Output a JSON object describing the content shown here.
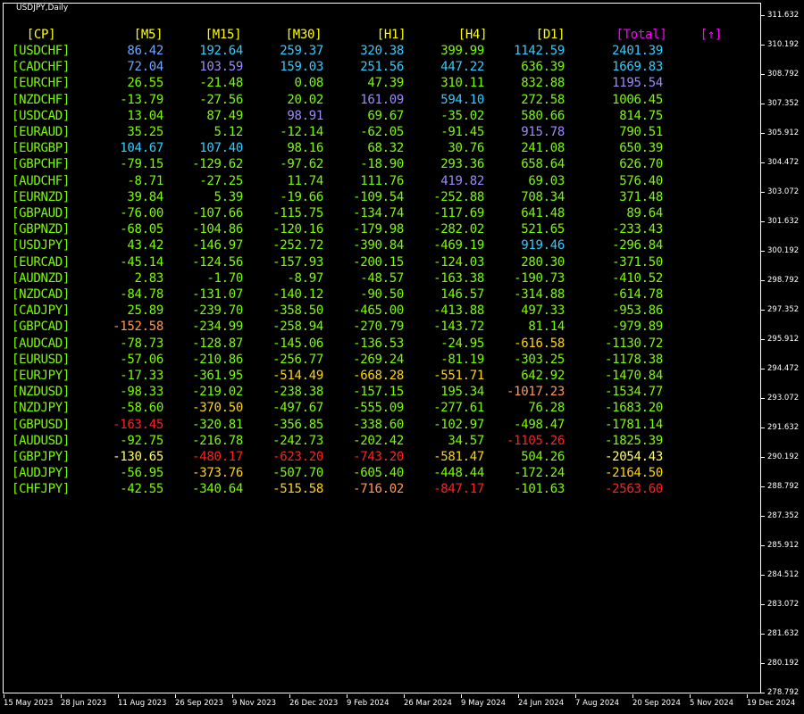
{
  "chart": {
    "title": "USDJPY,Daily",
    "price_labels": [
      "311.632",
      "310.192",
      "308.792",
      "307.352",
      "305.912",
      "304.472",
      "303.072",
      "301.632",
      "300.192",
      "298.792",
      "297.352",
      "295.912",
      "294.472",
      "293.072",
      "291.632",
      "290.192",
      "288.792",
      "287.352",
      "285.912",
      "284.512",
      "283.072",
      "281.632",
      "280.192",
      "278.792"
    ],
    "time_labels": [
      "15 May 2023",
      "28 Jun 2023",
      "11 Aug 2023",
      "26 Sep 2023",
      "9 Nov 2023",
      "26 Dec 2023",
      "9 Feb 2024",
      "26 Mar 2024",
      "9 May 2024",
      "24 Jun 2024",
      "7 Aug 2024",
      "20 Sep 2024",
      "5 Nov 2024",
      "19 Dec 2024"
    ]
  },
  "table": {
    "headers": [
      "[CP]",
      "[M5]",
      "[M15]",
      "[M30]",
      "[H1]",
      "[H4]",
      "[D1]",
      "[Total]",
      "[↑]"
    ],
    "header_colors": [
      "#ffff00",
      "#ffff00",
      "#ffff00",
      "#ffff00",
      "#ffff00",
      "#ffff00",
      "#ffff00",
      "#ff00ff",
      "#ff00ff"
    ],
    "rows": [
      {
        "pair": "[USDCHF]",
        "vals": [
          "86.42",
          "192.64",
          "259.37",
          "320.38",
          "399.99",
          "1142.59",
          "2401.39"
        ],
        "colors": [
          "#6fa8ff",
          "#33ccff",
          "#33ccff",
          "#33ccff",
          "#7cfc00",
          "#33ccff",
          "#33ccff"
        ]
      },
      {
        "pair": "[CADCHF]",
        "vals": [
          "72.04",
          "103.59",
          "159.03",
          "251.56",
          "447.22",
          "636.39",
          "1669.83"
        ],
        "colors": [
          "#6fa8ff",
          "#9b8cff",
          "#33ccff",
          "#33ccff",
          "#33ccff",
          "#7cfc00",
          "#33ccff"
        ]
      },
      {
        "pair": "[EURCHF]",
        "vals": [
          "26.55",
          "-21.48",
          "0.08",
          "47.39",
          "310.11",
          "832.88",
          "1195.54"
        ],
        "colors": [
          "#7cfc00",
          "#7cfc00",
          "#7cfc00",
          "#7cfc00",
          "#7cfc00",
          "#7cfc00",
          "#9b8cff"
        ]
      },
      {
        "pair": "[NZDCHF]",
        "vals": [
          "-13.79",
          "-27.56",
          "20.02",
          "161.09",
          "594.10",
          "272.58",
          "1006.45"
        ],
        "colors": [
          "#7cfc00",
          "#7cfc00",
          "#7cfc00",
          "#9b8cff",
          "#33ccff",
          "#7cfc00",
          "#7cfc00"
        ]
      },
      {
        "pair": "[USDCAD]",
        "vals": [
          "13.04",
          "87.49",
          "98.91",
          "69.67",
          "-35.02",
          "580.66",
          "814.75"
        ],
        "colors": [
          "#7cfc00",
          "#7cfc00",
          "#9b8cff",
          "#7cfc00",
          "#7cfc00",
          "#7cfc00",
          "#7cfc00"
        ]
      },
      {
        "pair": "[EURAUD]",
        "vals": [
          "35.25",
          "5.12",
          "-12.14",
          "-62.05",
          "-91.45",
          "915.78",
          "790.51"
        ],
        "colors": [
          "#7cfc00",
          "#7cfc00",
          "#7cfc00",
          "#7cfc00",
          "#7cfc00",
          "#9b8cff",
          "#7cfc00"
        ]
      },
      {
        "pair": "[EURGBP]",
        "vals": [
          "104.67",
          "107.40",
          "98.16",
          "68.32",
          "30.76",
          "241.08",
          "650.39"
        ],
        "colors": [
          "#33ccff",
          "#33ccff",
          "#7cfc00",
          "#7cfc00",
          "#7cfc00",
          "#7cfc00",
          "#7cfc00"
        ]
      },
      {
        "pair": "[GBPCHF]",
        "vals": [
          "-79.15",
          "-129.62",
          "-97.62",
          "-18.90",
          "293.36",
          "658.64",
          "626.70"
        ],
        "colors": [
          "#7cfc00",
          "#7cfc00",
          "#7cfc00",
          "#7cfc00",
          "#7cfc00",
          "#7cfc00",
          "#7cfc00"
        ]
      },
      {
        "pair": "[AUDCHF]",
        "vals": [
          "-8.71",
          "-27.25",
          "11.74",
          "111.76",
          "419.82",
          "69.03",
          "576.40"
        ],
        "colors": [
          "#7cfc00",
          "#7cfc00",
          "#7cfc00",
          "#7cfc00",
          "#9b8cff",
          "#7cfc00",
          "#7cfc00"
        ]
      },
      {
        "pair": "[EURNZD]",
        "vals": [
          "39.84",
          "5.39",
          "-19.66",
          "-109.54",
          "-252.88",
          "708.34",
          "371.48"
        ],
        "colors": [
          "#7cfc00",
          "#7cfc00",
          "#7cfc00",
          "#7cfc00",
          "#7cfc00",
          "#7cfc00",
          "#7cfc00"
        ]
      },
      {
        "pair": "[GBPAUD]",
        "vals": [
          "-76.00",
          "-107.66",
          "-115.75",
          "-134.74",
          "-117.69",
          "641.48",
          "89.64"
        ],
        "colors": [
          "#7cfc00",
          "#7cfc00",
          "#7cfc00",
          "#7cfc00",
          "#7cfc00",
          "#7cfc00",
          "#7cfc00"
        ]
      },
      {
        "pair": "[GBPNZD]",
        "vals": [
          "-68.05",
          "-104.86",
          "-120.16",
          "-179.98",
          "-282.02",
          "521.65",
          "-233.43"
        ],
        "colors": [
          "#7cfc00",
          "#7cfc00",
          "#7cfc00",
          "#7cfc00",
          "#7cfc00",
          "#7cfc00",
          "#7cfc00"
        ]
      },
      {
        "pair": "[USDJPY]",
        "vals": [
          "43.42",
          "-146.97",
          "-252.72",
          "-390.84",
          "-469.19",
          "919.46",
          "-296.84"
        ],
        "colors": [
          "#7cfc00",
          "#7cfc00",
          "#7cfc00",
          "#7cfc00",
          "#7cfc00",
          "#33ccff",
          "#7cfc00"
        ]
      },
      {
        "pair": "[EURCAD]",
        "vals": [
          "-45.14",
          "-124.56",
          "-157.93",
          "-200.15",
          "-124.03",
          "280.30",
          "-371.50"
        ],
        "colors": [
          "#7cfc00",
          "#7cfc00",
          "#7cfc00",
          "#7cfc00",
          "#7cfc00",
          "#7cfc00",
          "#7cfc00"
        ]
      },
      {
        "pair": "[AUDNZD]",
        "vals": [
          "2.83",
          "-1.70",
          "-8.97",
          "-48.57",
          "-163.38",
          "-190.73",
          "-410.52"
        ],
        "colors": [
          "#7cfc00",
          "#7cfc00",
          "#7cfc00",
          "#7cfc00",
          "#7cfc00",
          "#7cfc00",
          "#7cfc00"
        ]
      },
      {
        "pair": "[NZDCAD]",
        "vals": [
          "-84.78",
          "-131.07",
          "-140.12",
          "-90.50",
          "146.57",
          "-314.88",
          "-614.78"
        ],
        "colors": [
          "#7cfc00",
          "#7cfc00",
          "#7cfc00",
          "#7cfc00",
          "#7cfc00",
          "#7cfc00",
          "#7cfc00"
        ]
      },
      {
        "pair": "[CADJPY]",
        "vals": [
          "25.89",
          "-239.70",
          "-358.50",
          "-465.00",
          "-413.88",
          "497.33",
          "-953.86"
        ],
        "colors": [
          "#7cfc00",
          "#7cfc00",
          "#7cfc00",
          "#7cfc00",
          "#7cfc00",
          "#7cfc00",
          "#7cfc00"
        ]
      },
      {
        "pair": "[GBPCAD]",
        "vals": [
          "-152.58",
          "-234.99",
          "-258.94",
          "-270.79",
          "-143.72",
          "81.14",
          "-979.89"
        ],
        "colors": [
          "#ff9955",
          "#7cfc00",
          "#7cfc00",
          "#7cfc00",
          "#7cfc00",
          "#7cfc00",
          "#7cfc00"
        ]
      },
      {
        "pair": "[AUDCAD]",
        "vals": [
          "-78.73",
          "-128.87",
          "-145.06",
          "-136.53",
          "-24.95",
          "-616.58",
          "-1130.72"
        ],
        "colors": [
          "#7cfc00",
          "#7cfc00",
          "#7cfc00",
          "#7cfc00",
          "#7cfc00",
          "#ffd700",
          "#7cfc00"
        ]
      },
      {
        "pair": "[EURUSD]",
        "vals": [
          "-57.06",
          "-210.86",
          "-256.77",
          "-269.24",
          "-81.19",
          "-303.25",
          "-1178.38"
        ],
        "colors": [
          "#7cfc00",
          "#7cfc00",
          "#7cfc00",
          "#7cfc00",
          "#7cfc00",
          "#7cfc00",
          "#7cfc00"
        ]
      },
      {
        "pair": "[EURJPY]",
        "vals": [
          "-17.33",
          "-361.95",
          "-514.49",
          "-668.28",
          "-551.71",
          "642.92",
          "-1470.84"
        ],
        "colors": [
          "#7cfc00",
          "#7cfc00",
          "#ffd700",
          "#ffd700",
          "#ffd700",
          "#7cfc00",
          "#7cfc00"
        ]
      },
      {
        "pair": "[NZDUSD]",
        "vals": [
          "-98.33",
          "-219.02",
          "-238.38",
          "-157.15",
          "195.34",
          "-1017.23",
          "-1534.77"
        ],
        "colors": [
          "#7cfc00",
          "#7cfc00",
          "#7cfc00",
          "#7cfc00",
          "#7cfc00",
          "#ff9955",
          "#7cfc00"
        ]
      },
      {
        "pair": "[NZDJPY]",
        "vals": [
          "-58.60",
          "-370.50",
          "-497.67",
          "-555.09",
          "-277.61",
          "76.28",
          "-1683.20"
        ],
        "colors": [
          "#7cfc00",
          "#ffd700",
          "#7cfc00",
          "#7cfc00",
          "#7cfc00",
          "#7cfc00",
          "#7cfc00"
        ]
      },
      {
        "pair": "[GBPUSD]",
        "vals": [
          "-163.45",
          "-320.81",
          "-356.85",
          "-338.60",
          "-102.97",
          "-498.47",
          "-1781.14"
        ],
        "colors": [
          "#ff2020",
          "#7cfc00",
          "#7cfc00",
          "#7cfc00",
          "#7cfc00",
          "#7cfc00",
          "#7cfc00"
        ]
      },
      {
        "pair": "[AUDUSD]",
        "vals": [
          "-92.75",
          "-216.78",
          "-242.73",
          "-202.42",
          "34.57",
          "-1105.26",
          "-1825.39"
        ],
        "colors": [
          "#7cfc00",
          "#7cfc00",
          "#7cfc00",
          "#7cfc00",
          "#7cfc00",
          "#ff2020",
          "#7cfc00"
        ]
      },
      {
        "pair": "[GBPJPY]",
        "vals": [
          "-130.65",
          "-480.17",
          "-623.20",
          "-743.20",
          "-581.47",
          "504.26",
          "-2054.43"
        ],
        "colors": [
          "#ffff66",
          "#ff2020",
          "#ff2020",
          "#ff2020",
          "#ffd700",
          "#7cfc00",
          "#ffff66"
        ]
      },
      {
        "pair": "[AUDJPY]",
        "vals": [
          "-56.95",
          "-373.76",
          "-507.70",
          "-605.40",
          "-448.44",
          "-172.24",
          "-2164.50"
        ],
        "colors": [
          "#7cfc00",
          "#ffd700",
          "#7cfc00",
          "#7cfc00",
          "#7cfc00",
          "#7cfc00",
          "#ffd700"
        ]
      },
      {
        "pair": "[CHFJPY]",
        "vals": [
          "-42.55",
          "-340.64",
          "-515.58",
          "-716.02",
          "-847.17",
          "-101.63",
          "-2563.60"
        ],
        "colors": [
          "#7cfc00",
          "#7cfc00",
          "#ffd700",
          "#ff9955",
          "#ff2020",
          "#7cfc00",
          "#ff2020"
        ]
      }
    ],
    "pair_color": "#7cfc00"
  }
}
